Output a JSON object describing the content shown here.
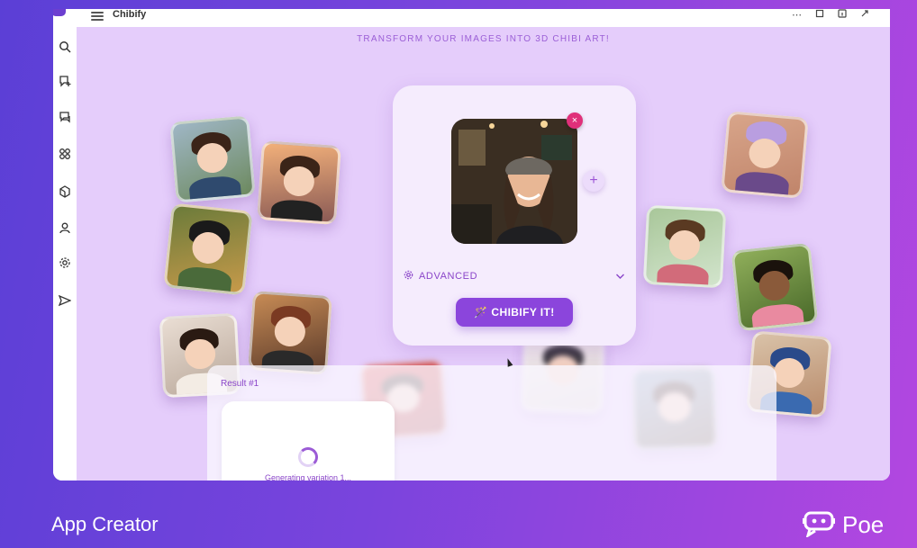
{
  "window": {
    "app_title": "Chibify",
    "toolbar_icons": [
      "more-icon",
      "copy-icon",
      "info-icon",
      "expand-icon"
    ]
  },
  "sidebar": {
    "items": [
      {
        "icon": "search-icon"
      },
      {
        "icon": "new-chat-icon"
      },
      {
        "icon": "chat-list-icon"
      },
      {
        "icon": "apps-icon"
      },
      {
        "icon": "bots-icon"
      },
      {
        "icon": "profile-icon"
      },
      {
        "icon": "settings-icon"
      },
      {
        "icon": "send-icon"
      }
    ]
  },
  "main": {
    "tagline": "TRANSFORM YOUR IMAGES INTO 3D CHIBI ART!",
    "advanced_label": "ADVANCED",
    "chibify_label": "🪄 CHIBIFY IT!",
    "close_glyph": "×",
    "add_glyph": "+"
  },
  "result": {
    "label": "Result #1",
    "status": "Generating variation 1..."
  },
  "footer": {
    "left": "App Creator",
    "brand": "Poe"
  },
  "colors": {
    "accent": "#8b45dc",
    "background": "#e5cdfb",
    "close_badge": "#e0307a"
  }
}
